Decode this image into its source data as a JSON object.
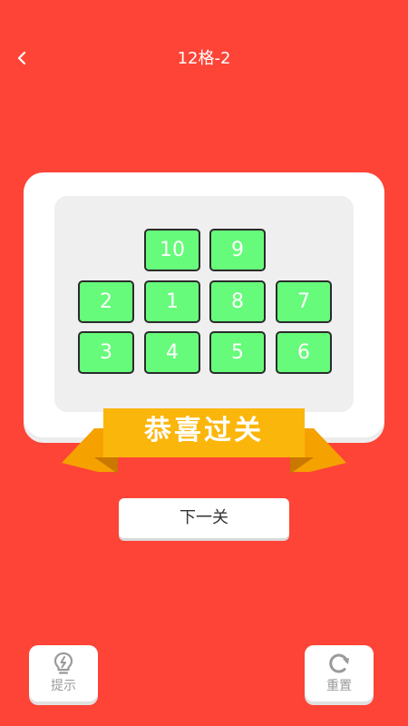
{
  "header": {
    "title": "12格-2"
  },
  "board": {
    "tiles": [
      {
        "label": "10",
        "row": 0,
        "col": 1
      },
      {
        "label": "9",
        "row": 0,
        "col": 2
      },
      {
        "label": "2",
        "row": 1,
        "col": 0
      },
      {
        "label": "1",
        "row": 1,
        "col": 1
      },
      {
        "label": "8",
        "row": 1,
        "col": 2
      },
      {
        "label": "7",
        "row": 1,
        "col": 3
      },
      {
        "label": "3",
        "row": 2,
        "col": 0
      },
      {
        "label": "4",
        "row": 2,
        "col": 1
      },
      {
        "label": "5",
        "row": 2,
        "col": 2
      },
      {
        "label": "6",
        "row": 2,
        "col": 3
      }
    ]
  },
  "result": {
    "banner_text": "恭喜过关",
    "next_button": "下一关"
  },
  "tools": {
    "hint_label": "提示",
    "reset_label": "重置"
  },
  "colors": {
    "background": "#FD4436",
    "tile": "#66FB7A",
    "banner": "#FBB60C",
    "banner_dark": "#E08A00"
  },
  "icons": {
    "back": "chevron-left-icon",
    "hint": "lightbulb-icon",
    "reset": "refresh-icon"
  }
}
